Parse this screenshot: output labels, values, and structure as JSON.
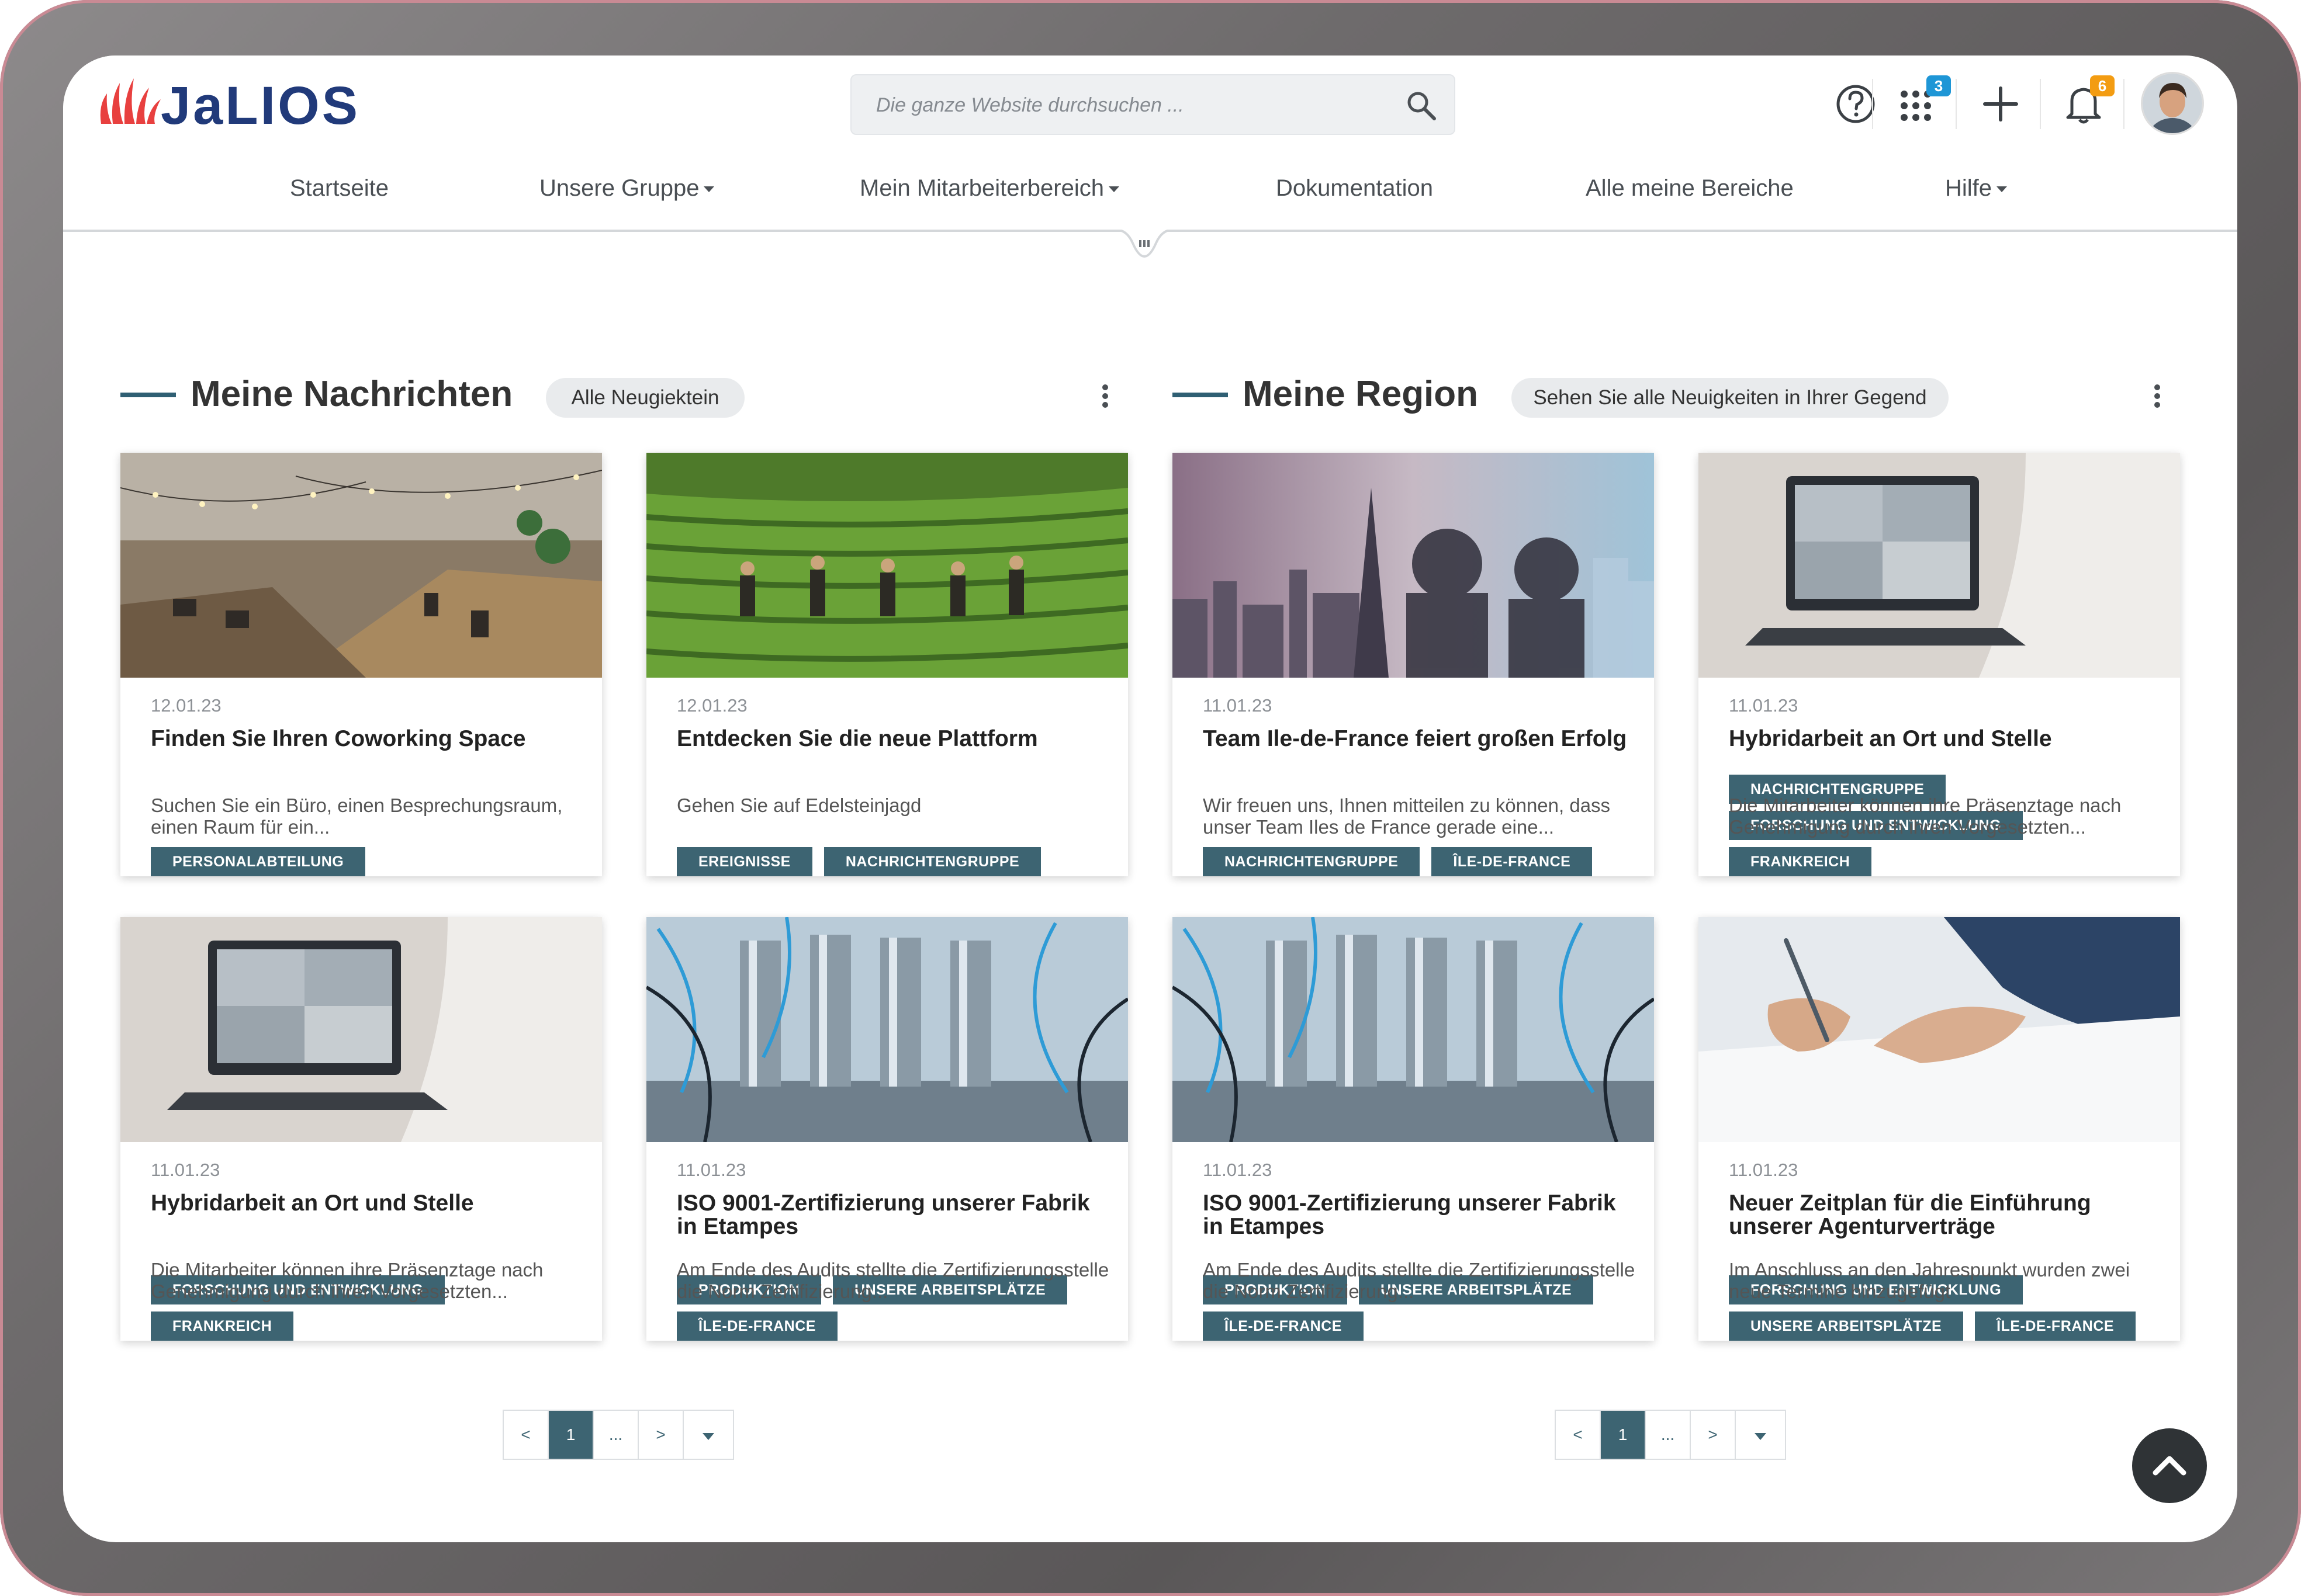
{
  "search": {
    "placeholder": "Die ganze Website durchsuchen ..."
  },
  "header": {
    "apps_badge": "3",
    "notifications_badge": "6"
  },
  "nav": [
    {
      "label": "Startseite",
      "dropdown": false
    },
    {
      "label": "Unsere Gruppe",
      "dropdown": true
    },
    {
      "label": "Mein Mitarbeiterbereich",
      "dropdown": true
    },
    {
      "label": "Dokumentation",
      "dropdown": false
    },
    {
      "label": "Alle meine Bereiche",
      "dropdown": false
    },
    {
      "label": "Hilfe",
      "dropdown": true
    }
  ],
  "sections": [
    {
      "title": "Meine Nachrichten",
      "button": "Alle Neugiektein",
      "cards": [
        {
          "tags": [
            [
              "PERSONALABTEILUNG"
            ]
          ],
          "date": "12.01.23",
          "title": "Finden Sie Ihren Coworking Space",
          "desc": "Suchen Sie ein Büro, einen Besprechungsraum, einen Raum für ein..."
        },
        {
          "tags": [
            [
              "EREIGNISSE",
              "NACHRICHTENGRUPPE"
            ]
          ],
          "date": "12.01.23",
          "title": "Entdecken Sie die neue Plattform",
          "desc": "Gehen Sie auf Edelsteinjagd"
        },
        {
          "tags": [
            [
              "FORSCHUNG UND ENTWICKLUNG"
            ],
            [
              "FRANKREICH"
            ]
          ],
          "date": "11.01.23",
          "title": "Hybridarbeit an Ort und Stelle",
          "desc": "Die Mitarbeiter können ihre Präsenztage nach Genehmigung durch ihren Vorgesetzten..."
        },
        {
          "tags": [
            [
              "PRODUKTION",
              "UNSERE ARBEITSPLÄTZE"
            ],
            [
              "ÎLE-DE-FRANCE"
            ]
          ],
          "date": "11.01.23",
          "title": "ISO 9001-Zertifizierung unserer Fabrik in Etampes",
          "desc": "Am Ende des Audits stellte die Zertifizierungsstelle die Norm Zertifizierung..."
        }
      ],
      "pager": {
        "prev": "<",
        "current": "1",
        "ellipsis": "...",
        "next": ">"
      }
    },
    {
      "title": "Meine Region",
      "button": "Sehen Sie alle Neuigkeiten in Ihrer Gegend",
      "cards": [
        {
          "tags": [
            [
              "NACHRICHTENGRUPPE",
              "ÎLE-DE-FRANCE"
            ]
          ],
          "date": "11.01.23",
          "title": "Team Ile-de-France feiert großen Erfolg",
          "desc": "Wir freuen uns, Ihnen mitteilen zu können, dass unser Team Iles de France gerade eine..."
        },
        {
          "tags": [
            [
              "NACHRICHTENGRUPPE"
            ],
            [
              "FORSCHUNG UND ENTWICKLUNG"
            ],
            [
              "FRANKREICH"
            ]
          ],
          "date": "11.01.23",
          "title": "Hybridarbeit an Ort und Stelle",
          "desc": "Die Mitarbeiter können ihre Präsenztage nach Genehmigung durch ihren Vorgesetzten..."
        },
        {
          "tags": [
            [
              "PRODUKTION",
              "UNSERE ARBEITSPLÄTZE"
            ],
            [
              "ÎLE-DE-FRANCE"
            ]
          ],
          "date": "11.01.23",
          "title": "ISO 9001-Zertifizierung unserer Fabrik in Etampes",
          "desc": "Am Ende des Audits stellte die Zertifizierungsstelle die Norm Zertifizierung..."
        },
        {
          "tags": [
            [
              "FORSCHUNG UND ENTWICKLUNG"
            ],
            [
              "UNSERE ARBEITSPLÄTZE",
              "ÎLE-DE-FRANCE"
            ]
          ],
          "date": "11.01.23",
          "title": "Neuer Zeitplan für die Einführung unserer Agenturverträge",
          "desc": "Im Anschluss an den Jahrespunkt wurden zwei neue Termine hinzugefügt"
        }
      ],
      "pager": {
        "prev": "<",
        "current": "1",
        "ellipsis": "...",
        "next": ">"
      }
    }
  ],
  "colors": {
    "accent": "#3d6472",
    "logo_red": "#e8403f",
    "logo_blue": "#213a7a",
    "badge_blue": "#1e96d6",
    "badge_orange": "#f39c12"
  }
}
